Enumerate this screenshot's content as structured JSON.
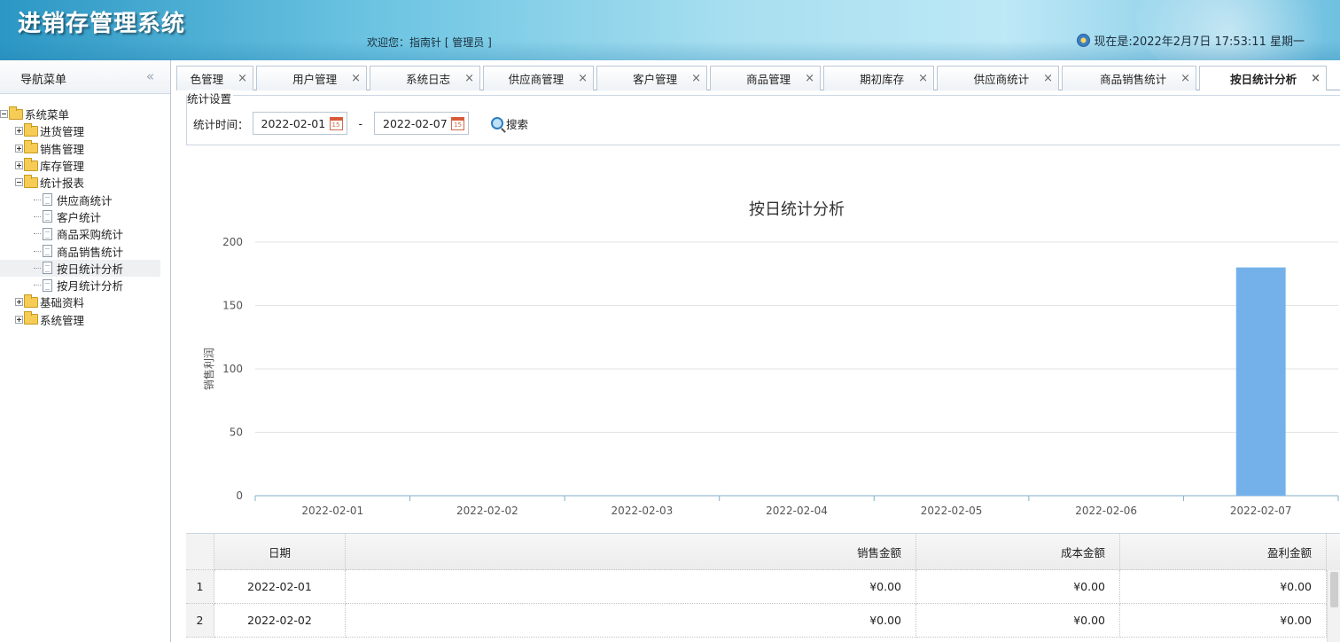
{
  "app": {
    "title": "进销存管理系统",
    "welcome": "欢迎您：指南针 [ 管理员 ]",
    "clock": "现在是:2022年2月7日 17:53:11 星期一"
  },
  "sidebar": {
    "title": "导航菜单",
    "collapse_glyph": "«",
    "tree": [
      {
        "label": "系统菜单",
        "level": 0,
        "type": "folder",
        "expanded": true
      },
      {
        "label": "进货管理",
        "level": 1,
        "type": "folder",
        "expanded": false
      },
      {
        "label": "销售管理",
        "level": 1,
        "type": "folder",
        "expanded": false
      },
      {
        "label": "库存管理",
        "level": 1,
        "type": "folder",
        "expanded": false
      },
      {
        "label": "统计报表",
        "level": 1,
        "type": "folder",
        "expanded": true
      },
      {
        "label": "供应商统计",
        "level": 2,
        "type": "doc"
      },
      {
        "label": "客户统计",
        "level": 2,
        "type": "doc"
      },
      {
        "label": "商品采购统计",
        "level": 2,
        "type": "doc"
      },
      {
        "label": "商品销售统计",
        "level": 2,
        "type": "doc"
      },
      {
        "label": "按日统计分析",
        "level": 2,
        "type": "doc",
        "selected": true
      },
      {
        "label": "按月统计分析",
        "level": 2,
        "type": "doc"
      },
      {
        "label": "基础资料",
        "level": 1,
        "type": "folder",
        "expanded": false
      },
      {
        "label": "系统管理",
        "level": 1,
        "type": "folder",
        "expanded": false
      }
    ]
  },
  "tabs": [
    {
      "label": "色管理",
      "active": false
    },
    {
      "label": "用户管理",
      "active": false
    },
    {
      "label": "系统日志",
      "active": false
    },
    {
      "label": "供应商管理",
      "active": false
    },
    {
      "label": "客户管理",
      "active": false
    },
    {
      "label": "商品管理",
      "active": false
    },
    {
      "label": "期初库存",
      "active": false
    },
    {
      "label": "供应商统计",
      "active": false
    },
    {
      "label": "商品销售统计",
      "active": false
    },
    {
      "label": "按日统计分析",
      "active": true
    }
  ],
  "tab_close_glyph": "×",
  "filter": {
    "legend": "统计设置",
    "label": "统计时间：",
    "start_date": "2022-02-01",
    "end_date": "2022-02-07",
    "separator": "-",
    "search_label": "搜索",
    "calendar_glyph": "15"
  },
  "chart_data": {
    "type": "bar",
    "title": "按日统计分析",
    "xlabel": "",
    "ylabel": "销售利润",
    "categories": [
      "2022-02-01",
      "2022-02-02",
      "2022-02-03",
      "2022-02-04",
      "2022-02-05",
      "2022-02-06",
      "2022-02-07"
    ],
    "values": [
      0,
      0,
      0,
      0,
      0,
      0,
      180
    ],
    "ylim": [
      0,
      200
    ],
    "yticks": [
      0,
      50,
      100,
      150,
      200
    ],
    "grid": true,
    "bar_color": "#74b1ea"
  },
  "table": {
    "columns": [
      "",
      "日期",
      "销售金额",
      "成本金额",
      "盈利金额"
    ],
    "rows": [
      {
        "num": "1",
        "date": "2022-02-01",
        "sale": "¥0.00",
        "cost": "¥0.00",
        "profit": "¥0.00"
      },
      {
        "num": "2",
        "date": "2022-02-02",
        "sale": "¥0.00",
        "cost": "¥0.00",
        "profit": "¥0.00"
      }
    ]
  },
  "colors": {
    "header_start": "#2c97c4",
    "header_end": "#bde8f6",
    "accent": "#74b1ea"
  }
}
